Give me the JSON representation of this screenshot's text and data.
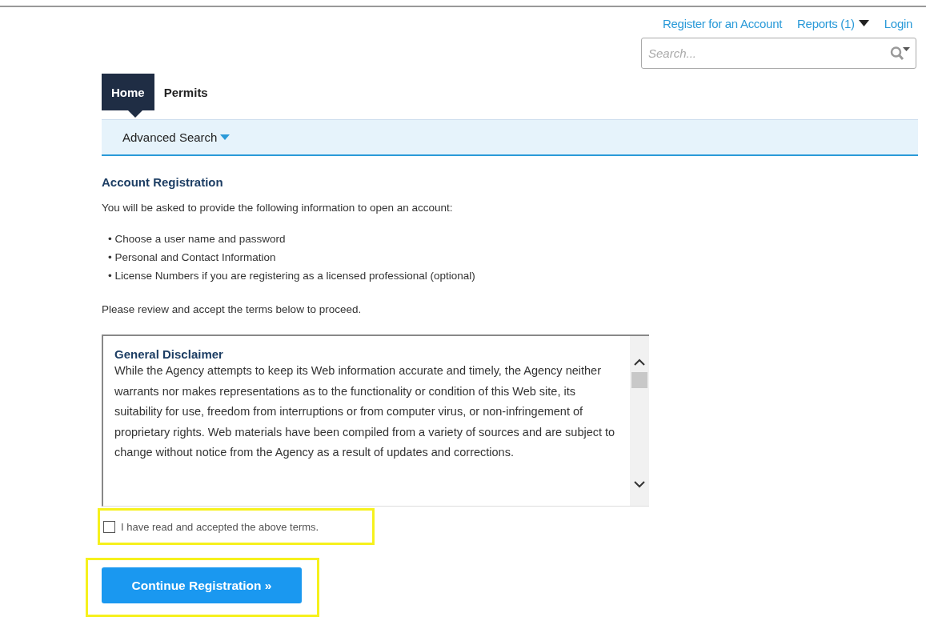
{
  "header_links": [
    {
      "label": "Register for an Account",
      "has_dropdown": false
    },
    {
      "label": "Reports (1)",
      "has_dropdown": true
    },
    {
      "label": "Login",
      "has_dropdown": false
    }
  ],
  "search": {
    "placeholder": "Search..."
  },
  "tabs": [
    {
      "label": "Home",
      "selected": true
    },
    {
      "label": "Permits",
      "selected": false
    }
  ],
  "subnav": {
    "label": "Advanced Search"
  },
  "heading": "Account Registration",
  "intro": "You will be asked to provide the following information to open an account:",
  "requirements": [
    "• Choose a user name and password",
    "• Personal and Contact Information",
    "• License Numbers if you are registering as a licensed professional (optional)"
  ],
  "instruction": "Please review and accept the terms below to proceed.",
  "disclaimer": {
    "title": "General Disclaimer",
    "text": "While the Agency attempts to keep its Web information accurate and timely, the Agency neither warrants nor makes representations as to the functionality or condition of this Web site, its suitability for use, freedom from interruptions or from computer virus, or non-infringement of proprietary rights. Web materials have been compiled from a variety of sources and are subject to change without notice from the Agency as a result of updates and corrections."
  },
  "accept": {
    "label": "I have read and accepted the above terms.",
    "checked": false,
    "highlighted": true
  },
  "continue_button": {
    "label": "Continue Registration »",
    "highlighted": true
  }
}
